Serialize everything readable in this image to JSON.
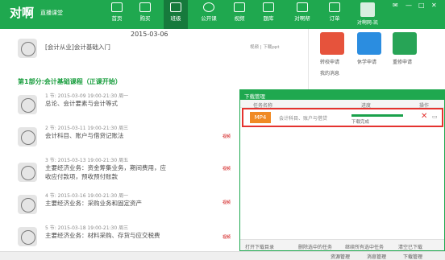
{
  "app": {
    "logo": "对啊",
    "logo_sub": "直播课堂"
  },
  "nav": [
    {
      "label": "首页"
    },
    {
      "label": "购买"
    },
    {
      "label": "班级"
    },
    {
      "label": "公开课"
    },
    {
      "label": "视频"
    },
    {
      "label": "题库"
    },
    {
      "label": "对啊帮"
    },
    {
      "label": "订单"
    }
  ],
  "user": {
    "name": "对啊网-凯"
  },
  "date": "2015-03-06",
  "intro_lesson": {
    "title": "[会计从业]会计基础入门",
    "meta": "视频 | 下载ppt"
  },
  "section_title": "第1部分:会计基础课程（正课开始）",
  "lessons": [
    {
      "meta": "1 节:  2015-03-09 19:00-21:30  周一",
      "title": "总论、会计要素与会计等式"
    },
    {
      "meta": "2 节:  2015-03-11 19:00-21:30  周三",
      "title": "会计科目、账户与借贷记账法"
    },
    {
      "meta": "3 节:  2015-03-13 19:00-21:30  周五",
      "title": "主要经济业务：资金筹集业务，期间费用，应收应付款项，预收预付账款"
    },
    {
      "meta": "4 节:  2015-03-16 19:00-21:30  周一",
      "title": "主要经济业务：采购业务和固定资产"
    },
    {
      "meta": "5 节:  2015-03-18 19:00-21:30  周三",
      "title": "主要经济业务：材料采购、存货与应交税费"
    }
  ],
  "side": {
    "video": "视频"
  },
  "right_panel": {
    "buttons": [
      "转校申请",
      "休学申请",
      "重修申请"
    ],
    "my_msgs": "我的消息"
  },
  "download": {
    "title": "下载管理",
    "columns": {
      "name": "任务名称",
      "progress": "进度",
      "op": "操作"
    },
    "item": {
      "type": "MP4",
      "name": "会计科目、账户与借贷",
      "status": "下载完成",
      "progress": 1.0
    },
    "footer": [
      "打开下载目录",
      "删除选中的任务",
      "继续所有选中任务",
      "清空已下载"
    ]
  },
  "bottombar": [
    "资源管理",
    "消息管理",
    "下载管理"
  ]
}
